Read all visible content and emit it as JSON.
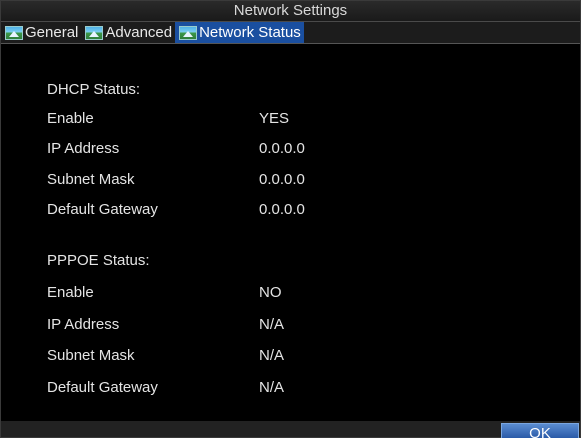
{
  "window": {
    "title": "Network Settings"
  },
  "tabs": [
    {
      "label": "General",
      "active": false
    },
    {
      "label": "Advanced",
      "active": false
    },
    {
      "label": "Network Status",
      "active": true
    }
  ],
  "dhcp": {
    "heading": "DHCP Status:",
    "rows": [
      {
        "label": "Enable",
        "value": "YES"
      },
      {
        "label": "IP Address",
        "value": "0.0.0.0"
      },
      {
        "label": "Subnet Mask",
        "value": "0.0.0.0"
      },
      {
        "label": "Default Gateway",
        "value": "0.0.0.0"
      }
    ]
  },
  "pppoe": {
    "heading": "PPPOE Status:",
    "rows": [
      {
        "label": "Enable",
        "value": "NO"
      },
      {
        "label": "IP Address",
        "value": "N/A"
      },
      {
        "label": "Subnet Mask",
        "value": "N/A"
      },
      {
        "label": "Default Gateway",
        "value": "N/A"
      }
    ]
  },
  "footer": {
    "ok_label": "OK"
  },
  "colors": {
    "background": "#000000",
    "active_tab": "#1a4fa0",
    "ok_button": "#2a5aa8",
    "text": "#e4e4e4"
  },
  "icons": {
    "tab_icon": "landscape-picture-icon"
  }
}
